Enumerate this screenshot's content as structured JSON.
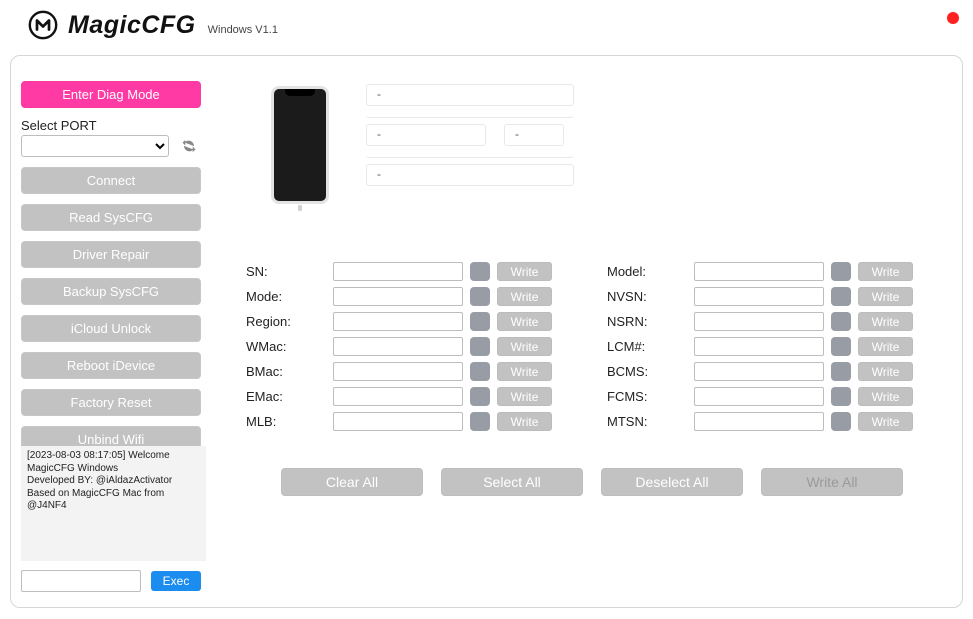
{
  "header": {
    "title": "MagicCFG",
    "version": "Windows V1.1"
  },
  "sidebar": {
    "enter_diag": "Enter Diag Mode",
    "port_label": "Select PORT",
    "port_value": "",
    "connect": "Connect",
    "read_syscfg": "Read SysCFG",
    "driver_repair": "Driver Repair",
    "backup_syscfg": "Backup SysCFG",
    "icloud_unlock": "iCloud Unlock",
    "reboot": "Reboot iDevice",
    "factory_reset": "Factory Reset",
    "unbind_wifi": "Unbind Wifi"
  },
  "log": {
    "line1": "[2023-08-03 08:17:05] Welcome MagicCFG Windows",
    "line2": "Developed BY: @iAldazActivator Based on MagicCFG Mac from @J4NF4"
  },
  "exec": {
    "value": "",
    "button": "Exec"
  },
  "info": {
    "line1": "-",
    "line2": "",
    "line3a": "-",
    "line3b": "-",
    "line4": "",
    "line5": "-"
  },
  "fields": {
    "write_label": "Write",
    "left": [
      {
        "label": "SN:",
        "value": ""
      },
      {
        "label": "Mode:",
        "value": ""
      },
      {
        "label": "Region:",
        "value": ""
      },
      {
        "label": "WMac:",
        "value": ""
      },
      {
        "label": "BMac:",
        "value": ""
      },
      {
        "label": "EMac:",
        "value": ""
      },
      {
        "label": "MLB:",
        "value": ""
      }
    ],
    "right": [
      {
        "label": "Model:",
        "value": ""
      },
      {
        "label": "NVSN:",
        "value": ""
      },
      {
        "label": "NSRN:",
        "value": ""
      },
      {
        "label": "LCM#:",
        "value": ""
      },
      {
        "label": "BCMS:",
        "value": ""
      },
      {
        "label": "FCMS:",
        "value": ""
      },
      {
        "label": "MTSN:",
        "value": ""
      }
    ]
  },
  "actions": {
    "clear_all": "Clear All",
    "select_all": "Select All",
    "deselect_all": "Deselect All",
    "write_all": "Write All"
  }
}
